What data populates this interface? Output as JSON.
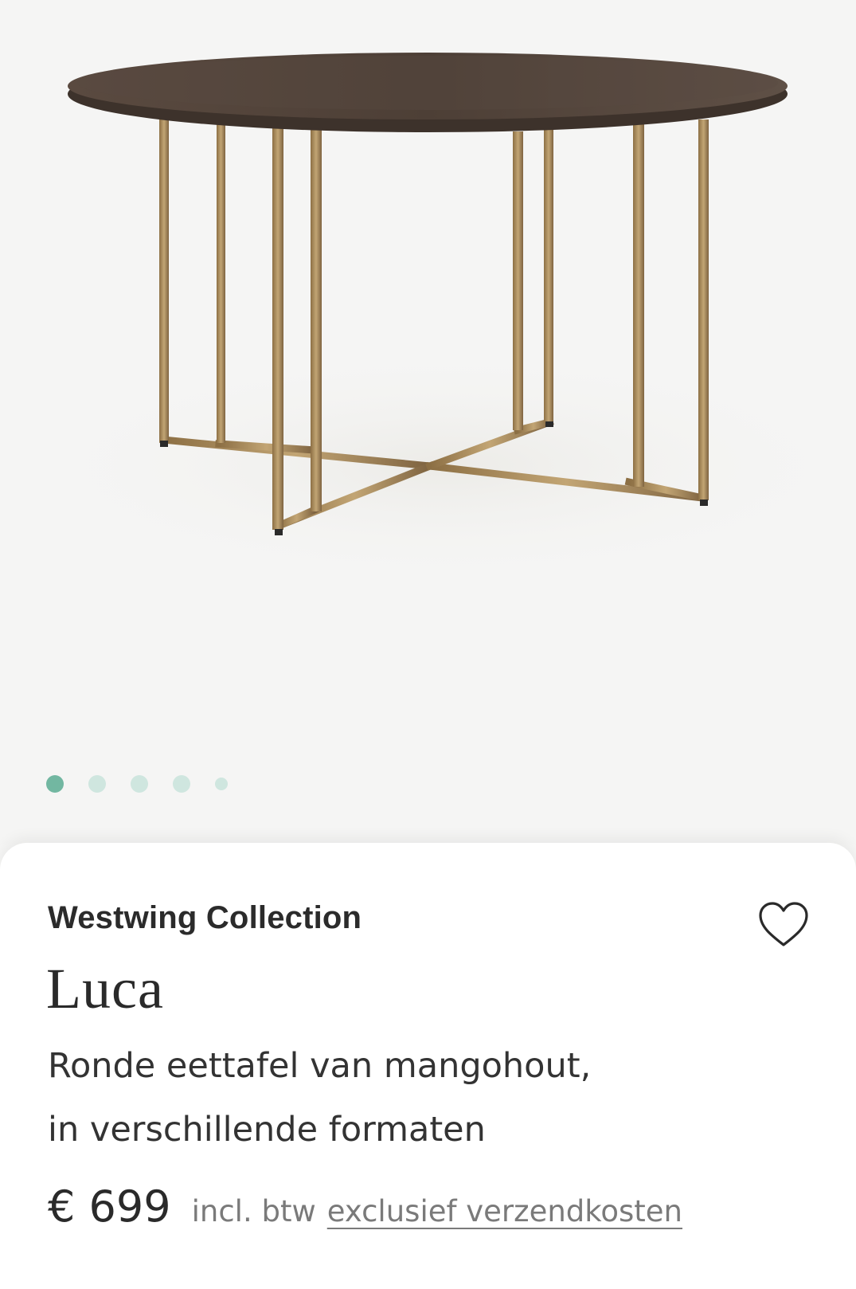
{
  "gallery": {
    "image_alt": "Luca ronde eettafel",
    "dots": [
      {
        "active": true,
        "size": "large"
      },
      {
        "active": false,
        "size": "large"
      },
      {
        "active": false,
        "size": "large"
      },
      {
        "active": false,
        "size": "large"
      },
      {
        "active": false,
        "size": "small"
      }
    ],
    "colors": {
      "dot_active": "#72b7a1",
      "dot_inactive": "#cfe6df",
      "table_top": "#4e4038",
      "table_frame": "#a88a5a"
    }
  },
  "product": {
    "brand": "Westwing Collection",
    "name": "Luca",
    "description_line1": "Ronde eettafel van mangohout,",
    "description_line2": "in verschillende formaten",
    "price": "€ 699",
    "vat_label": "incl. btw",
    "shipping_link": "exclusief verzendkosten",
    "favorite_icon": "heart-outline-icon"
  }
}
